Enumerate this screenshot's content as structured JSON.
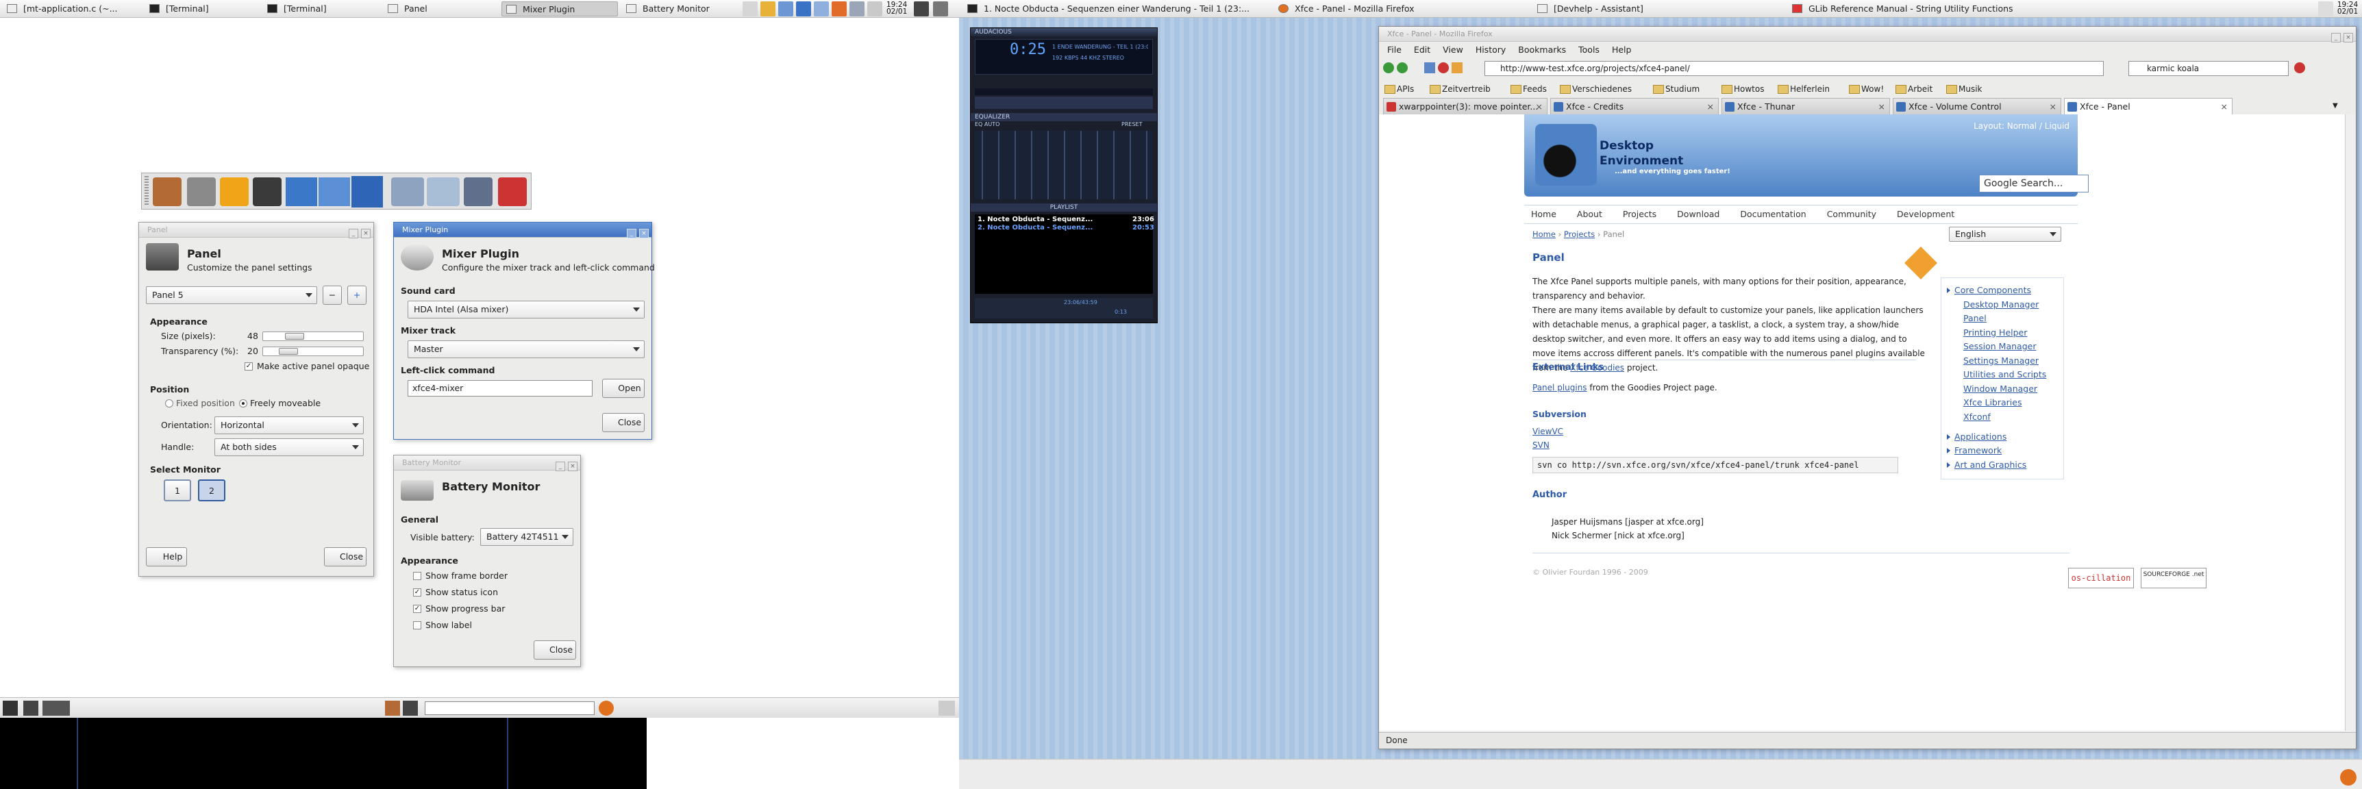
{
  "left_screen": {
    "taskbar": {
      "tasks": [
        "[mt-application.c (~...",
        "[Terminal]",
        "[Terminal]",
        "Panel",
        "Mixer Plugin",
        "Battery Monitor"
      ],
      "clock_time": "19:24",
      "clock_date": "02/01"
    },
    "panel_window": {
      "title": "Panel",
      "header_title": "Panel",
      "header_subtitle": "Customize the panel settings",
      "panel_select": "Panel 5",
      "appearance_label": "Appearance",
      "size_label": "Size (pixels):",
      "size_value": "48",
      "size_fraction": 0.28,
      "transparency_label": "Transparency (%):",
      "transparency_value": "20",
      "transparency_fraction": 0.2,
      "opaque_label": "Make active panel opaque",
      "position_label": "Position",
      "fixed_label": "Fixed position",
      "freely_label": "Freely moveable",
      "orientation_label": "Orientation:",
      "orientation_value": "Horizontal",
      "handle_label": "Handle:",
      "handle_value": "At both sides",
      "monitor_label": "Select Monitor",
      "monitor_1": "1",
      "monitor_2": "2",
      "help_label": "Help",
      "close_label": "Close"
    },
    "mixer_window": {
      "title": "Mixer Plugin",
      "header_title": "Mixer Plugin",
      "header_subtitle": "Configure the mixer track and left-click command",
      "sound_card_label": "Sound card",
      "sound_card_value": "HDA Intel (Alsa mixer)",
      "mixer_track_label": "Mixer track",
      "mixer_track_value": "Master",
      "left_click_label": "Left-click command",
      "left_click_value": "xfce4-mixer",
      "open_label": "Open",
      "close_label": "Close"
    },
    "battery_window": {
      "title": "Battery Monitor",
      "header_title": "Battery Monitor",
      "general_label": "General",
      "visible_battery_label": "Visible battery:",
      "visible_battery_value": "Battery 42T4511",
      "appearance_label": "Appearance",
      "show_frame_border": "Show frame border",
      "show_status_icon": "Show status icon",
      "show_progress_bar": "Show progress bar",
      "show_label": "Show label",
      "close_label": "Close"
    }
  },
  "right_screen": {
    "taskbar": {
      "tasks": [
        "1. Nocte Obducta - Sequenzen einer Wanderung - Teil 1 (23:...",
        "Xfce - Panel - Mozilla Firefox",
        "[Devhelp - Assistant]",
        "GLib Reference Manual - String Utility Functions"
      ],
      "clock_time": "19:24",
      "clock_date": "02/01"
    },
    "audacious": {
      "title": "AUDACIOUS",
      "time": "0:25",
      "song_scroll": "1 ENDE WANDERUNG - TEIL 1 (23:06)",
      "kbps": "192",
      "khz": "44",
      "mode": "STEREO",
      "equalizer_title": "EQUALIZER",
      "eq_on": "EQ",
      "eq_auto": "AUTO",
      "eq_presets": "PRESET",
      "playlist_title": "PLAYLIST",
      "playlist": [
        {
          "entry": "1. Nocte Obducta - Sequenz...",
          "time": "23:06"
        },
        {
          "entry": "2. Nocte Obducta - Sequenz...",
          "time": "20:53"
        }
      ],
      "total_time": "0:13",
      "playlist_info": "23:06/43:59"
    },
    "firefox": {
      "window_title": "Xfce - Panel - Mozilla Firefox",
      "menu": [
        "File",
        "Edit",
        "View",
        "History",
        "Bookmarks",
        "Tools",
        "Help"
      ],
      "url": "http://www-test.xfce.org/projects/xfce4-panel/",
      "search_text": "karmic koala",
      "bookmarks": [
        "APIs",
        "Zeitvertreib",
        "Feeds",
        "Verschiedenes",
        "Studium",
        "Howtos",
        "Helferlein",
        "Wow!",
        "Arbeit",
        "Musik"
      ],
      "tabs": [
        "xwarppointer(3): move pointer...",
        "Xfce - Credits",
        "Xfce - Thunar",
        "Xfce - Volume Control",
        "Xfce - Panel"
      ],
      "status": "Done",
      "page": {
        "layout_label": "Layout: Normal / Liquid",
        "logo_title": "Desktop",
        "logo_title2": "Environment",
        "logo_tagline": "...and everything goes faster!",
        "google_search": "Google Search...",
        "nav": [
          "Home",
          "About",
          "Projects",
          "Download",
          "Documentation",
          "Community",
          "Development"
        ],
        "breadcrumb": [
          "Home",
          "Projects",
          "Panel"
        ],
        "language": "English",
        "heading": "Panel",
        "intro": "The Xfce Panel supports multiple panels, with many options for their position, appearance, transparency and behavior.",
        "body_a": "There are many items available by default to customize your panels, like application launchers with detachable menus, a graphical pager, a tasklist, a clock, a system tray, a show/hide desktop switcher, and even more. It offers an easy way to add items using a dialog, and to move items accross different panels. It's compatible with the numerous panel plugins available from the ",
        "body_link": "Xfce Goodies",
        "body_b": " project.",
        "external_links_title": "External Links",
        "panel_plugins_link": "Panel plugins",
        "panel_plugins_text": "from the Goodies Project page.",
        "subversion_title": "Subversion",
        "viewvc": "ViewVC",
        "svn": "SVN",
        "svn_command": "svn co http://svn.xfce.org/svn/xfce/xfce4-panel/trunk xfce4-panel",
        "author_title": "Author",
        "authors": [
          "Jasper Huijsmans [jasper at xfce.org]",
          "Nick Schermer [nick at xfce.org]"
        ],
        "footer": "© Olivier Fourdan 1996 - 2009",
        "badge1": "os-cillation",
        "badge2": "SOURCEFORGE .net",
        "side_core": "Core Components",
        "side_items": [
          "Desktop Manager",
          "Panel",
          "Printing Helper",
          "Session Manager",
          "Settings Manager",
          "Utilities and Scripts",
          "Window Manager",
          "Xfce Libraries",
          "Xfconf"
        ],
        "side_more": [
          "Applications",
          "Framework",
          "Art and Graphics"
        ]
      }
    }
  }
}
